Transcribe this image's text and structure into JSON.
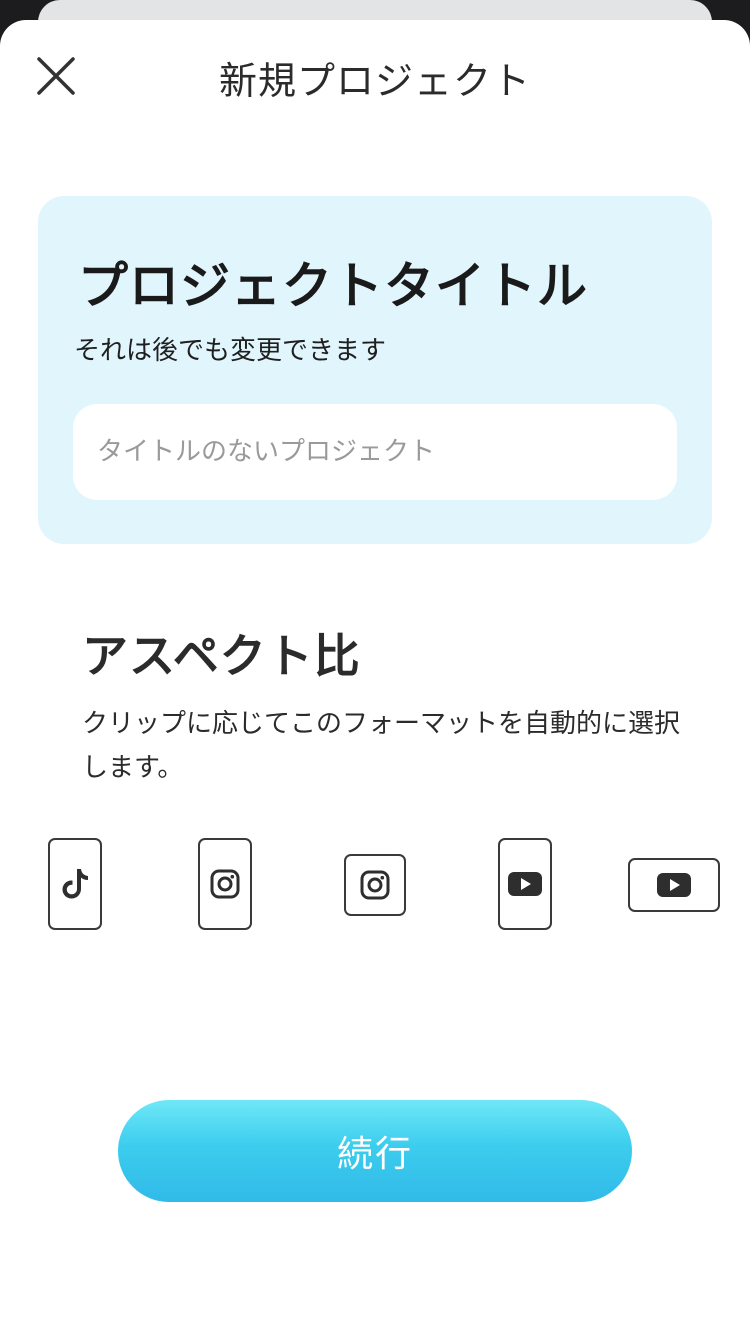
{
  "header": {
    "title": "新規プロジェクト"
  },
  "title_card": {
    "heading": "プロジェクトタイトル",
    "subtitle": "それは後でも変更できます",
    "input_value": "",
    "input_placeholder": "タイトルのないプロジェクト"
  },
  "aspect": {
    "heading": "アスペクト比",
    "description": "クリップに応じてこのフォーマットを自動的に選択します。"
  },
  "formats": [
    {
      "icon": "tiktok-icon"
    },
    {
      "icon": "instagram-icon"
    },
    {
      "icon": "instagram-icon"
    },
    {
      "icon": "youtube-icon"
    },
    {
      "icon": "youtube-icon"
    }
  ],
  "continue_label": "続行",
  "colors": {
    "accent": "#35c3eb",
    "card_bg": "#e1f5fd",
    "icon": "#2e2e2e"
  }
}
